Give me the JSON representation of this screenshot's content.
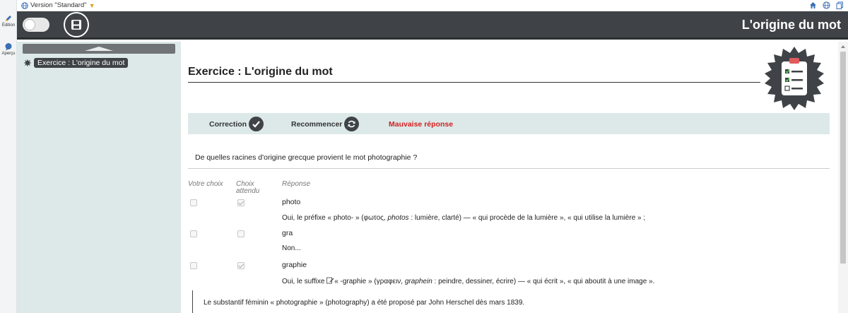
{
  "rail": {
    "edition_label": "Édition",
    "apercu_label": "Aperçu"
  },
  "topbar": {
    "version_label": "Version \"Standard\"",
    "icons": [
      "home-icon",
      "globe-icon",
      "copy-icon"
    ]
  },
  "header": {
    "title": "L'origine du mot"
  },
  "tree": {
    "item_label": "Exercice : L'origine du mot"
  },
  "exercise": {
    "title": "Exercice : L'origine du mot",
    "toolbar": {
      "correction_label": "Correction",
      "recommencer_label": "Recommencer",
      "status": "Mauvaise réponse"
    },
    "question": "De quelles racines d'origine grecque provient le mot photographie ?",
    "columns": {
      "votre_choix": "Votre choix",
      "choix_attendu_1": "Choix",
      "choix_attendu_2": "attendu",
      "reponse": "Réponse"
    },
    "answers": [
      {
        "label": "photo",
        "votre_choix": false,
        "choix_attendu": true,
        "feedback_pre": "Oui, le préfixe « photo- » (φωτος, ",
        "feedback_italic": "photos",
        "feedback_post": " : lumière, clarté) — « qui procède de la lumière », « qui utilise la lumière » ;"
      },
      {
        "label": "gra",
        "votre_choix": false,
        "choix_attendu": false,
        "feedback_pre": "Non...",
        "feedback_italic": "",
        "feedback_post": ""
      },
      {
        "label": "graphie",
        "votre_choix": false,
        "choix_attendu": true,
        "feedback_pre": "Oui, le suffixe ",
        "feedback_mid": "« -graphie » (γραφειν, ",
        "feedback_italic": "graphein",
        "feedback_post": " : peindre, dessiner, écrire) — « qui écrit », « qui aboutit à une image »."
      }
    ],
    "note": "Le substantif féminin « photographie » (photography) a été proposé par John Herschel dès mars 1839."
  },
  "colors": {
    "header_bg": "#3f4347",
    "panel_bg": "#dce9e8",
    "status_red": "#d42020"
  }
}
